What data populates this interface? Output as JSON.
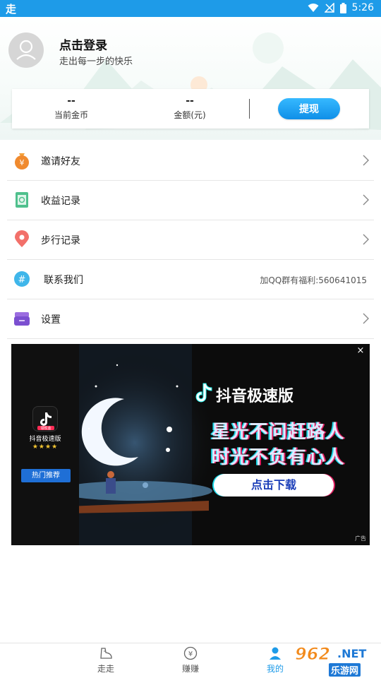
{
  "status_bar": {
    "time": "5:26",
    "app_glyph": "走"
  },
  "header": {
    "login_title": "点击登录",
    "login_subtitle": "走出每一步的快乐"
  },
  "stats": {
    "coins_value": "--",
    "coins_label": "当前金币",
    "amount_value": "--",
    "amount_label": "金额(元)",
    "withdraw_label": "提现"
  },
  "menu": {
    "invite": "邀请好友",
    "income": "收益记录",
    "steps": "步行记录",
    "contact": "联系我们",
    "contact_extra": "加QQ群有福利:560641015",
    "settings": "设置"
  },
  "ad": {
    "app_name": "抖音极速版",
    "app_badge": "领现金",
    "stars": "★★★★",
    "hot_label": "热门推荐",
    "brand": "抖音极速版",
    "slogan_1": "星光不问赶路人",
    "slogan_2": "时光不负有心人",
    "cta": "点击下载",
    "ad_tag": "广告",
    "close": "×"
  },
  "tabs": [
    {
      "label": "走走",
      "icon": "shoe-icon"
    },
    {
      "label": "赚赚",
      "icon": "yuan-coin-icon"
    },
    {
      "label": "我的",
      "icon": "person-icon"
    }
  ],
  "watermark": {
    "num": "962",
    "net": ".NET",
    "cn": "乐游网"
  },
  "colors": {
    "primary": "#1e9be8",
    "withdraw": "#0f8fe8",
    "ad_bg": "#0c0c0c"
  }
}
